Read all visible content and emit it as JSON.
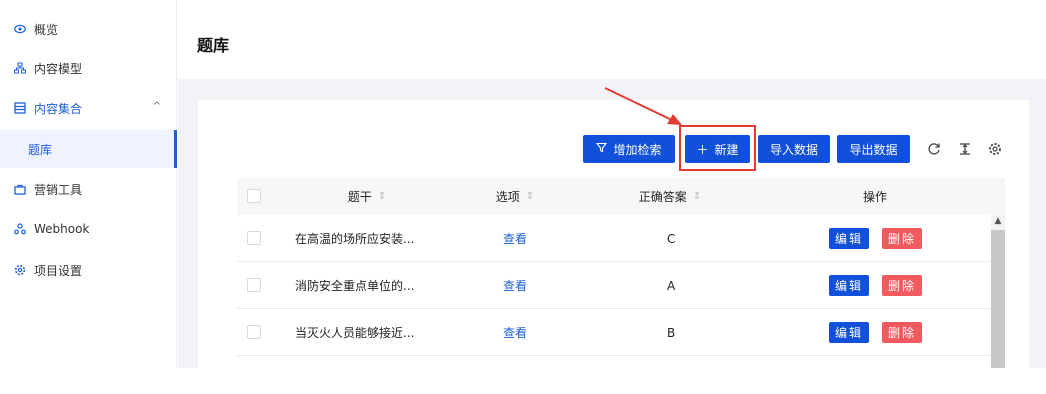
{
  "sidebar": {
    "items": [
      {
        "label": "概览",
        "icon": "eye-icon"
      },
      {
        "label": "内容模型",
        "icon": "sitemap-icon"
      },
      {
        "label": "内容集合",
        "icon": "list-icon",
        "caret": "^"
      },
      {
        "label": "题库"
      },
      {
        "label": "营销工具",
        "icon": "bag-icon"
      },
      {
        "label": "Webhook",
        "icon": "webhook-icon"
      },
      {
        "label": "项目设置",
        "icon": "gear-icon"
      }
    ]
  },
  "header": {
    "title": "题库"
  },
  "toolbar": {
    "add_filter_label": "增加检索",
    "new_label": "新建",
    "import_label": "导入数据",
    "export_label": "导出数据"
  },
  "table": {
    "columns": [
      "题干",
      "选项",
      "正确答案",
      "操作"
    ],
    "rows": [
      {
        "stem": "在高温的场所应安装...",
        "options": "查看",
        "answer": "C"
      },
      {
        "stem": "消防安全重点单位的...",
        "options": "查看",
        "answer": "A"
      },
      {
        "stem": "当灭火人员能够接近...",
        "options": "查看",
        "answer": "B"
      }
    ],
    "edit_label": "编辑",
    "delete_label": "删除"
  },
  "colors": {
    "primary": "#1150d8",
    "danger": "#f15a5e",
    "annotation": "#e23b34"
  }
}
